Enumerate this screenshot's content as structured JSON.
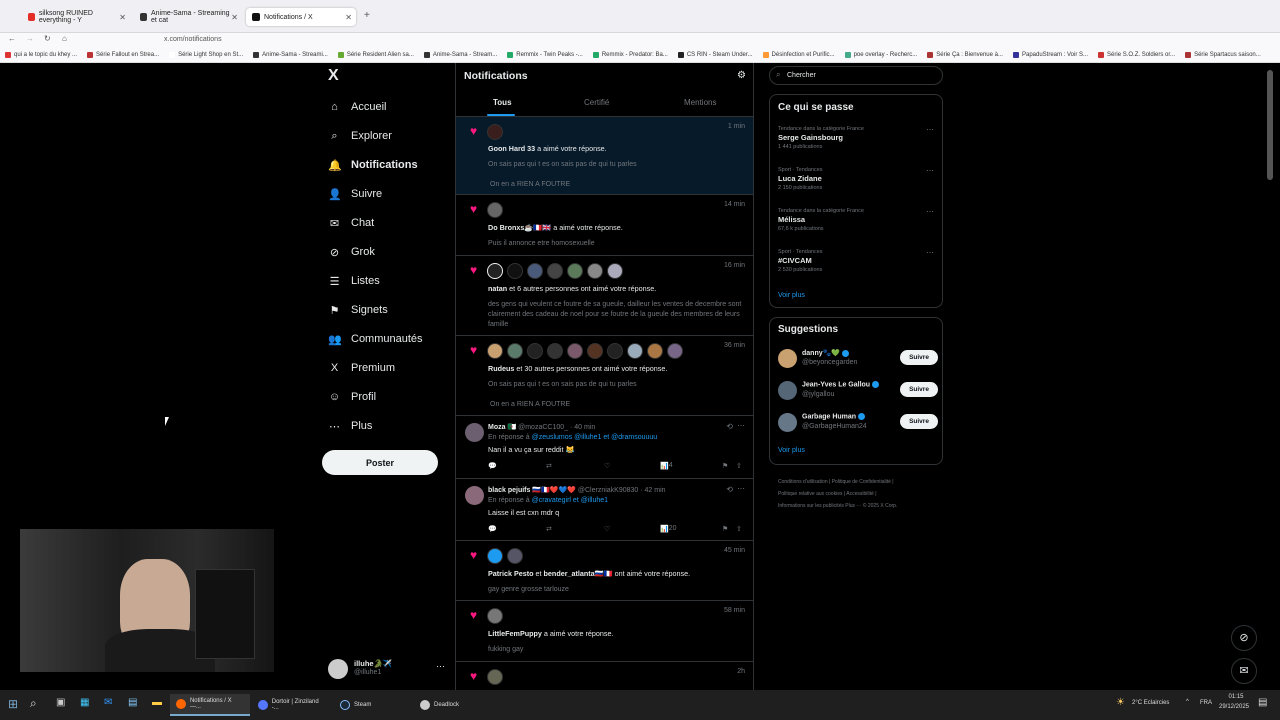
{
  "browser": {
    "tabs": [
      {
        "label": "silksong RUINED everything - Y",
        "color": "#e52d27"
      },
      {
        "label": "Anime-Sama - Streaming et cat",
        "color": "#333"
      },
      {
        "label": "Notifications / X",
        "color": "#111"
      }
    ],
    "url": "x.com/notifications",
    "bookmarks": [
      "qui a le topic du khey ...",
      "Série Fallout en Strea...",
      "Série Light Shop en St...",
      "Anime-Sama - Streami...",
      "Série Resident Alien sa...",
      "Anime-Sama - Stream...",
      "Remmix - Twin Peaks -...",
      "Remmix - Predator: Ba...",
      "CS RIN - Steam Under...",
      "Désinfection et Purific...",
      "poe overlay - Recherc...",
      "Série Ça : Bienvenue à...",
      "PapaduStream : Voir S...",
      "Série S.O.Z. Soldiers or...",
      "Série Spartacus saison..."
    ]
  },
  "nav": {
    "logo": "X",
    "items": [
      {
        "label": "Accueil",
        "icon": "home-icon",
        "glyph": "⌂"
      },
      {
        "label": "Explorer",
        "icon": "search-icon",
        "glyph": "⌕"
      },
      {
        "label": "Notifications",
        "icon": "bell-icon",
        "glyph": "🔔"
      },
      {
        "label": "Suivre",
        "icon": "follow-icon",
        "glyph": "👤"
      },
      {
        "label": "Chat",
        "icon": "mail-icon",
        "glyph": "✉"
      },
      {
        "label": "Grok",
        "icon": "grok-icon",
        "glyph": "⊘"
      },
      {
        "label": "Listes",
        "icon": "list-icon",
        "glyph": "☰"
      },
      {
        "label": "Signets",
        "icon": "bookmark-icon",
        "glyph": "⚑"
      },
      {
        "label": "Communautés",
        "icon": "community-icon",
        "glyph": "👥"
      },
      {
        "label": "Premium",
        "icon": "x-premium-icon",
        "glyph": "X"
      },
      {
        "label": "Profil",
        "icon": "profile-icon",
        "glyph": "☺"
      },
      {
        "label": "Plus",
        "icon": "more-icon",
        "glyph": "⋯"
      }
    ],
    "post": "Poster",
    "account_name": "illuhe🐊✈️",
    "account_handle": "@illuhe1"
  },
  "main": {
    "title": "Notifications",
    "tabs": [
      "Tous",
      "Certifié",
      "Mentions"
    ],
    "n1": {
      "time": "1 min",
      "name": "Goon Hard 33",
      "action": " a aimé votre réponse.",
      "quote1": "On sais pas qui t es on sais pas de qui tu parles",
      "quote2": "On en a RIEN A FOUTRE"
    },
    "n2": {
      "time": "14 min",
      "name": "Do Bronxs☕🇫🇷🇬🇧",
      "action": " a aimé votre réponse.",
      "quote": "Puis il annonce etre homosexuelle"
    },
    "n3": {
      "time": "16 min",
      "name": "natan",
      "action": " et 6 autres personnes ont aimé votre réponse.",
      "quote": "des gens qui veulent ce foutre de sa gueule, dailleur les ventes de decembre sont clairement des cadeau de noel pour se foutre de la gueule des membres de leurs famille"
    },
    "n4": {
      "time": "36 min",
      "name": "Rudeus",
      "action": " et 30 autres personnes ont aimé votre réponse.",
      "quote1": "On sais pas qui t es on sais pas de qui tu parles",
      "quote2": "On en a RIEN A FOUTRE"
    },
    "r1": {
      "name": "Moza 🇩🇿",
      "handle": "@mozaCC100_ · 40 min",
      "reply_prefix": "En réponse à ",
      "mentions": "@zeuslumos @illuhe1  et  @dramsouuuu",
      "text": "Nan il a vu ça sur reddit 😹",
      "views": "4"
    },
    "r2": {
      "name": "black pejuifs 🇷🇺🇫🇷❤️💙❤️",
      "handle": "@ClerzniakK90830 · 42 min",
      "reply_prefix": "En réponse à ",
      "mentions": "@cravategirl  et  @illuhe1",
      "text": "Laisse il est cxn mdr q",
      "views": "20"
    },
    "n5": {
      "time": "45 min",
      "name": "Patrick Pesto",
      "name2": "bender_atlanta🇷🇺🇫🇷",
      "action": " ont aimé votre réponse.",
      "quote": "gay genre grosse tarlouze"
    },
    "n6": {
      "time": "58 min",
      "name": "LittleFemPuppy",
      "action": " a aimé votre réponse.",
      "quote": "fukking gay"
    },
    "n7": {
      "time": "2h"
    }
  },
  "right": {
    "search_placeholder": "Chercher",
    "trends_title": "Ce qui se passe",
    "trends": [
      {
        "cat": "Tendance dans la catégorie France",
        "name": "Serge Gainsbourg",
        "count": "1 441 publications"
      },
      {
        "cat": "Sport · Tendances",
        "name": "Luca Zidane",
        "count": "2 150 publications"
      },
      {
        "cat": "Tendance dans la catégorie France",
        "name": "Mélissa",
        "count": "67,6 k publications"
      },
      {
        "cat": "Sport · Tendances",
        "name": "#CIVCAM",
        "count": "2 530 publications"
      }
    ],
    "more": "Voir plus",
    "suggestions_title": "Suggestions",
    "suggestions": [
      {
        "name": "danny🐾💚",
        "handle": "@beyoncegarden",
        "button": "Suivre"
      },
      {
        "name": "Jean-Yves Le Gallou",
        "handle": "@jylgallou",
        "button": "Suivre"
      },
      {
        "name": "Garbage Human",
        "handle": "@GarbageHuman24",
        "button": "Suivre"
      }
    ],
    "more2": "Voir plus",
    "footer": [
      "Conditions d'utilisation",
      "Politique de Confidentialité",
      "Politique relative aux cookies",
      "Accessibilité",
      "Informations sur les publicités",
      "Plus ···",
      "© 2025 X Corp."
    ]
  },
  "taskbar": {
    "apps": [
      "Notifications / X —...",
      "Dortoir | Zinziland -...",
      "Steam",
      "Deadlock"
    ],
    "weather": "2°C  Eclaircies",
    "lang": "FRA",
    "time": "01:15",
    "date": "29/12/2025"
  }
}
